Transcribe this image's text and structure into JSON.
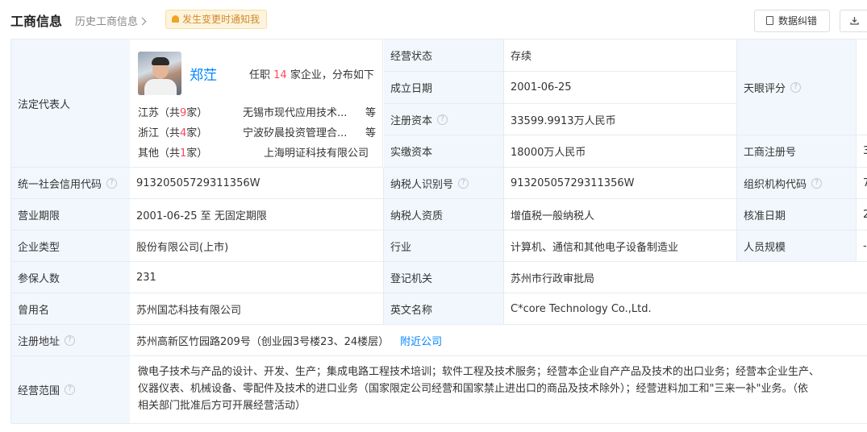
{
  "header": {
    "title": "工商信息",
    "history": "历史工商信息",
    "notify": "发生变更时通知我",
    "correct_btn": "数据纠错"
  },
  "rep": {
    "label": "法定代表人",
    "name": "郑茳",
    "summary_prefix": "任职",
    "count": "14",
    "summary_suffix": "家企业，分布如下",
    "provinces": [
      {
        "prefix": "江苏（共",
        "count": "9",
        "suffix": "家）",
        "company": "无锡市现代应用技术...",
        "more": "等"
      },
      {
        "prefix": "浙江（共",
        "count": "4",
        "suffix": "家）",
        "company": "宁波矽晨投资管理合...",
        "more": "等"
      },
      {
        "prefix": "其他（共",
        "count": "1",
        "suffix": "家）",
        "company": "上海明证科技有限公司",
        "more": ""
      }
    ]
  },
  "fields": {
    "status_label": "经营状态",
    "status_value": "存续",
    "estab_label": "成立日期",
    "estab_value": "2001-06-25",
    "capital_label": "注册资本",
    "capital_value": "33599.9913万人民币",
    "paid_label": "实缴资本",
    "paid_value": "18000万人民币",
    "tianyan_label": "天眼评分",
    "regno_label": "工商注册号",
    "regno_value": "3",
    "uscc_label": "统一社会信用代码",
    "uscc_value": "91320505729311356W",
    "taxid_label": "纳税人识别号",
    "taxid_value": "91320505729311356W",
    "orgcode_label": "组织机构代码",
    "orgcode_value": "7",
    "term_label": "营业期限",
    "term_value": "2001-06-25 至 无固定期限",
    "taxq_label": "纳税人资质",
    "taxq_value": "增值税一般纳税人",
    "approve_label": "核准日期",
    "approve_value": "2",
    "type_label": "企业类型",
    "type_value": "股份有限公司(上市)",
    "industry_label": "行业",
    "industry_value": "计算机、通信和其他电子设备制造业",
    "staff_label": "人员规模",
    "staff_value": "-",
    "insured_label": "参保人数",
    "insured_value": "231",
    "authority_label": "登记机关",
    "authority_value": "苏州市行政审批局",
    "former_label": "曾用名",
    "former_value": "苏州国芯科技有限公司",
    "en_label": "英文名称",
    "en_value": "C*core Technology Co.,Ltd.",
    "addr_label": "注册地址",
    "addr_value": "苏州高新区竹园路209号（创业园3号楼23、24楼层）",
    "nearby": "附近公司",
    "scope_label": "经营范围",
    "scope_lines": [
      "微电子技术与产品的设计、开发、生产；集成电路工程技术培训；软件工程及技术服务；经营本企业自产产品及技术的出口业务；经营本企业生产、",
      "仪器仪表、机械设备、零配件及技术的进口业务（国家限定公司经营和国家禁止进出口的商品及技术除外）；经营进料加工和\"三来一补\"业务。（依",
      "相关部门批准后方可开展经营活动）"
    ]
  }
}
